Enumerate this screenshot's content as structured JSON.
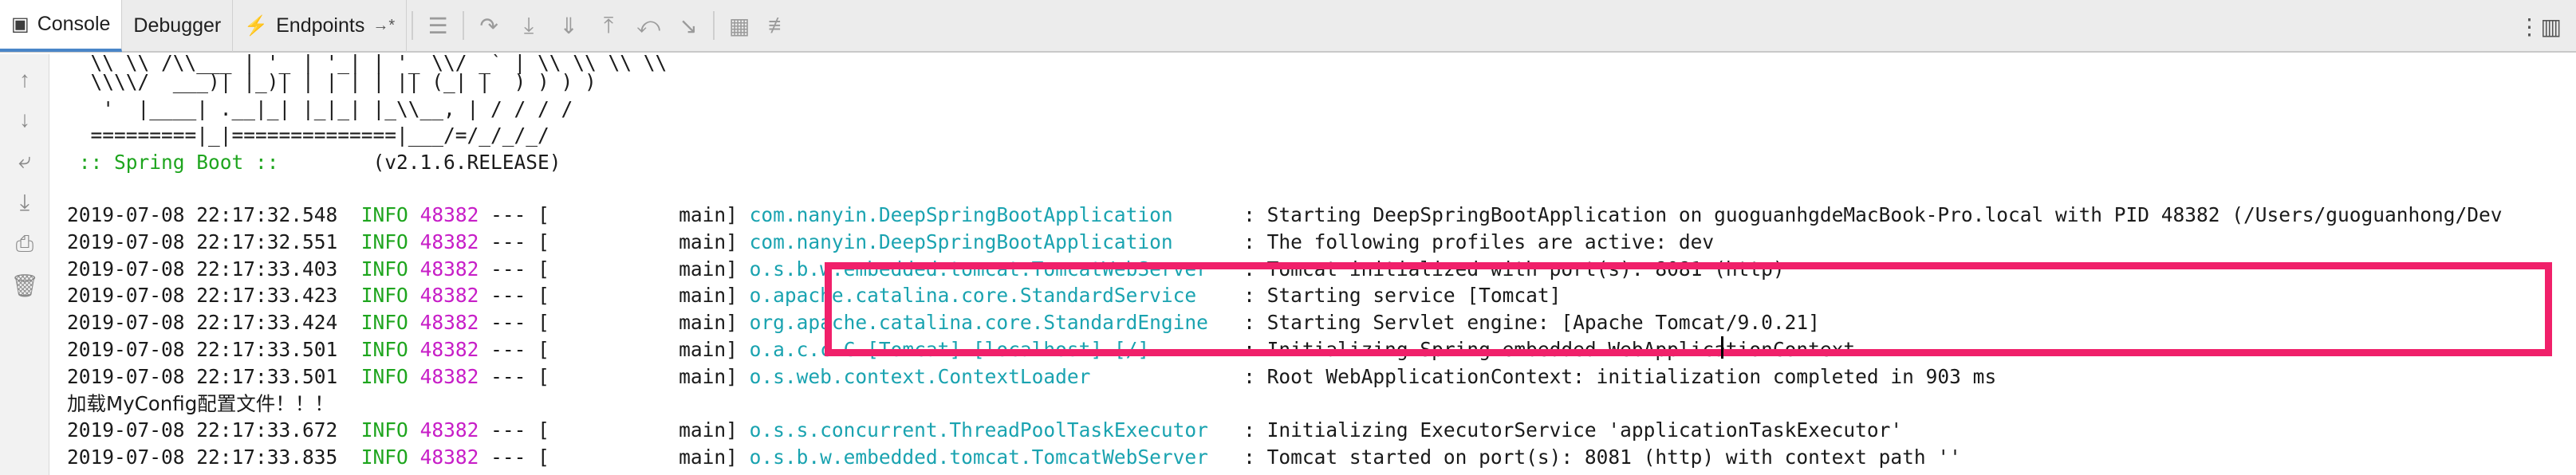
{
  "tabs": [
    {
      "label": "Console",
      "icon": "console-icon"
    },
    {
      "label": "Debugger",
      "icon": ""
    },
    {
      "label": "Endpoints",
      "icon": "endpoints-icon"
    }
  ],
  "pin_glyph": "→*",
  "banner": [
    "  \\\\ \\\\ /\\\\___ | '_ | '_| | '_ \\\\/ _` | \\\\ \\\\ \\\\ \\\\",
    "  \\\\\\\\/  ___)| |_)| | | | | || (_| |  ) ) ) )",
    "   '  |____| .__|_| |_|_| |_\\\\__, | / / / /",
    "  =========|_|==============|___/=/_/_/_/"
  ],
  "spring_boot": {
    "label": " :: Spring Boot :: ",
    "version": "       (v2.1.6.RELEASE)"
  },
  "logs": [
    {
      "ts": "2019-07-08 22:17:32.548",
      "level": "INFO",
      "pid": "48382",
      "sep": "---",
      "thread": "[           main]",
      "logger": "com.nanyin.DeepSpringBootApplication     ",
      "msg": " : Starting DeepSpringBootApplication on guoguanhgdeMacBook-Pro.local with PID 48382 (/Users/guoguanhong/Dev"
    },
    {
      "ts": "2019-07-08 22:17:32.551",
      "level": "INFO",
      "pid": "48382",
      "sep": "---",
      "thread": "[           main]",
      "logger": "com.nanyin.DeepSpringBootApplication     ",
      "msg": " : The following profiles are active: dev"
    },
    {
      "ts": "2019-07-08 22:17:33.403",
      "level": "INFO",
      "pid": "48382",
      "sep": "---",
      "thread": "[           main]",
      "logger": "o.s.b.w.embedded.tomcat.TomcatWebServer  ",
      "msg": " : Tomcat initialized with port(s): 8081 (http)"
    },
    {
      "ts": "2019-07-08 22:17:33.423",
      "level": "INFO",
      "pid": "48382",
      "sep": "---",
      "thread": "[           main]",
      "logger": "o.apache.catalina.core.StandardService   ",
      "msg": " : Starting service [Tomcat]"
    },
    {
      "ts": "2019-07-08 22:17:33.424",
      "level": "INFO",
      "pid": "48382",
      "sep": "---",
      "thread": "[           main]",
      "logger": "org.apache.catalina.core.StandardEngine  ",
      "msg": " : Starting Servlet engine: [Apache Tomcat/9.0.21]"
    },
    {
      "ts": "2019-07-08 22:17:33.501",
      "level": "INFO",
      "pid": "48382",
      "sep": "---",
      "thread": "[           main]",
      "logger": "o.a.c.c.C.[Tomcat].[localhost].[/]       ",
      "msg": " : Initializing Spring embedded WebApplicationContext"
    },
    {
      "ts": "2019-07-08 22:17:33.501",
      "level": "INFO",
      "pid": "48382",
      "sep": "---",
      "thread": "[           main]",
      "logger": "o.s.web.context.ContextLoader            ",
      "msg": " : Root WebApplicationContext: initialization completed in 903 ms"
    },
    {
      "plain": "加载MyConfig配置文件！！！"
    },
    {
      "ts": "2019-07-08 22:17:33.672",
      "level": "INFO",
      "pid": "48382",
      "sep": "---",
      "thread": "[           main]",
      "logger": "o.s.s.concurrent.ThreadPoolTaskExecutor  ",
      "msg": " : Initializing ExecutorService 'applicationTaskExecutor'"
    },
    {
      "ts": "2019-07-08 22:17:33.835",
      "level": "INFO",
      "pid": "48382",
      "sep": "---",
      "thread": "[           main]",
      "logger": "o.s.b.w.embedded.tomcat.TomcatWebServer  ",
      "msg": " : Tomcat started on port(s): 8081 (http) with context path ''"
    }
  ],
  "colors": {
    "info": "#1ea51e",
    "pid": "#c71ec7",
    "logger": "#1aa3b0",
    "highlight": "#f0206a"
  }
}
